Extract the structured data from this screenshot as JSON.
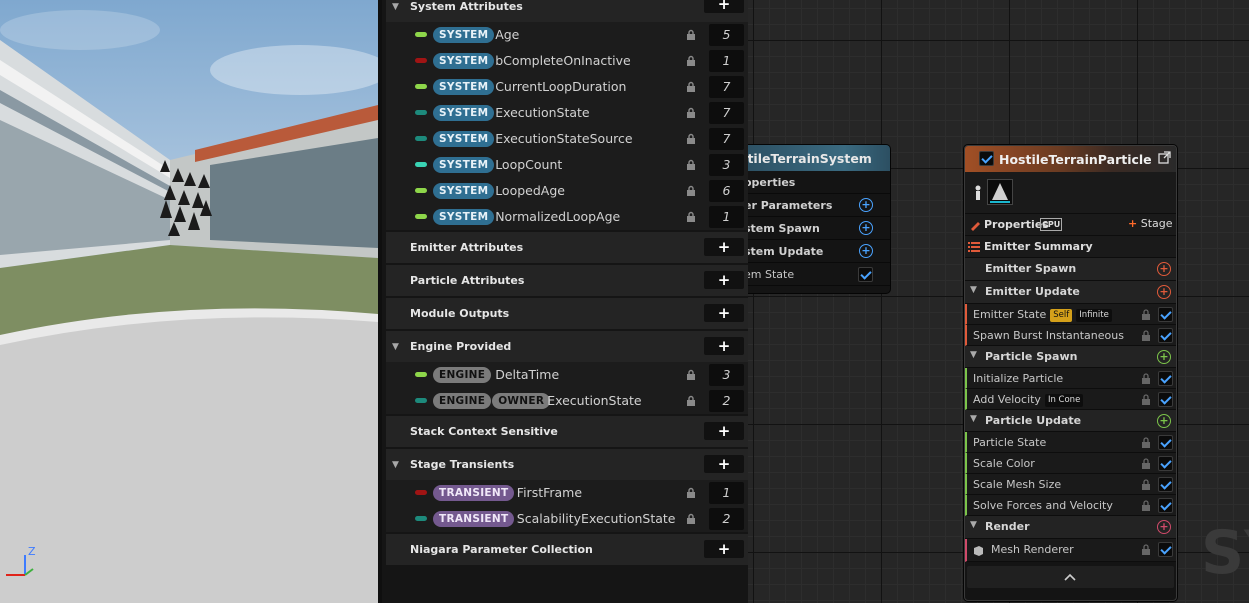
{
  "parameters": {
    "system_attributes": {
      "label": "System Attributes",
      "add_label": "+",
      "items": [
        {
          "badge": "SYSTEM",
          "name": "Age",
          "value": "5",
          "pill_color": "#8ed64a"
        },
        {
          "badge": "SYSTEM",
          "name": "bCompleteOnInactive",
          "value": "1",
          "pill_color": "#a01414"
        },
        {
          "badge": "SYSTEM",
          "name": "CurrentLoopDuration",
          "value": "7",
          "pill_color": "#8ed64a"
        },
        {
          "badge": "SYSTEM",
          "name": "ExecutionState",
          "value": "7",
          "pill_color": "#1d8a7c"
        },
        {
          "badge": "SYSTEM",
          "name": "ExecutionStateSource",
          "value": "7",
          "pill_color": "#1d8a7c"
        },
        {
          "badge": "SYSTEM",
          "name": "LoopCount",
          "value": "3",
          "pill_color": "#3ad3b4"
        },
        {
          "badge": "SYSTEM",
          "name": "LoopedAge",
          "value": "6",
          "pill_color": "#8ed64a"
        },
        {
          "badge": "SYSTEM",
          "name": "NormalizedLoopAge",
          "value": "1",
          "pill_color": "#8ed64a"
        }
      ]
    },
    "emitter_attributes": {
      "label": "Emitter Attributes"
    },
    "particle_attributes": {
      "label": "Particle Attributes"
    },
    "module_outputs": {
      "label": "Module Outputs"
    },
    "engine_provided": {
      "label": "Engine Provided",
      "items": [
        {
          "badges": [
            "ENGINE"
          ],
          "name": "DeltaTime",
          "value": "3",
          "pill_color": "#8ed64a"
        },
        {
          "badges": [
            "ENGINE",
            "OWNER"
          ],
          "name": "ExecutionState",
          "value": "2",
          "pill_color": "#1d8a7c"
        }
      ]
    },
    "stack_context_sensitive": {
      "label": "Stack Context Sensitive"
    },
    "stage_transients": {
      "label": "Stage Transients",
      "items": [
        {
          "badge": "TRANSIENT",
          "name": "FirstFrame",
          "value": "1",
          "pill_color": "#a01414"
        },
        {
          "badge": "TRANSIENT",
          "name": "ScalabilityExecutionState",
          "value": "2",
          "pill_color": "#1d8a7c"
        }
      ]
    },
    "npc": {
      "label": "Niagara Parameter Collection"
    }
  },
  "system_node": {
    "title": "stileTerrainSystem",
    "rows": [
      "operties",
      "er Parameters",
      "stem Spawn",
      "stem Update",
      "em State"
    ]
  },
  "emitter_node": {
    "title": "HostileTerrainParticle",
    "properties_label": "Properties",
    "cpu_label": "CPU",
    "stage_label": "Stage",
    "summary_label": "Emitter Summary",
    "emitter_spawn": "Emitter Spawn",
    "emitter_update": "Emitter Update",
    "emitter_state": "Emitter State",
    "self_tag": "Self",
    "infinite_tag": "Infinite",
    "spawn_burst": "Spawn Burst Instantaneous",
    "particle_spawn": "Particle Spawn",
    "initialize_particle": "Initialize Particle",
    "add_velocity": "Add Velocity",
    "in_cone_tag": "In Cone",
    "particle_update": "Particle Update",
    "particle_state": "Particle State",
    "scale_color": "Scale Color",
    "scale_mesh_size": "Scale Mesh Size",
    "solve_forces": "Solve Forces and Velocity",
    "render": "Render",
    "mesh_renderer": "Mesh Renderer"
  },
  "viewport": {
    "axis_z": "Z"
  },
  "watermark": "SY",
  "colors": {
    "system_badge": "#2f6f92",
    "engine_badge": "#7b7b7b",
    "transient_badge": "#74598f",
    "checkbox_accent": "#4aa3ff",
    "add_blue": "#4aa3ff",
    "add_orange": "#e05a3a",
    "add_green": "#7cc44a",
    "add_pink": "#d04a6a"
  }
}
